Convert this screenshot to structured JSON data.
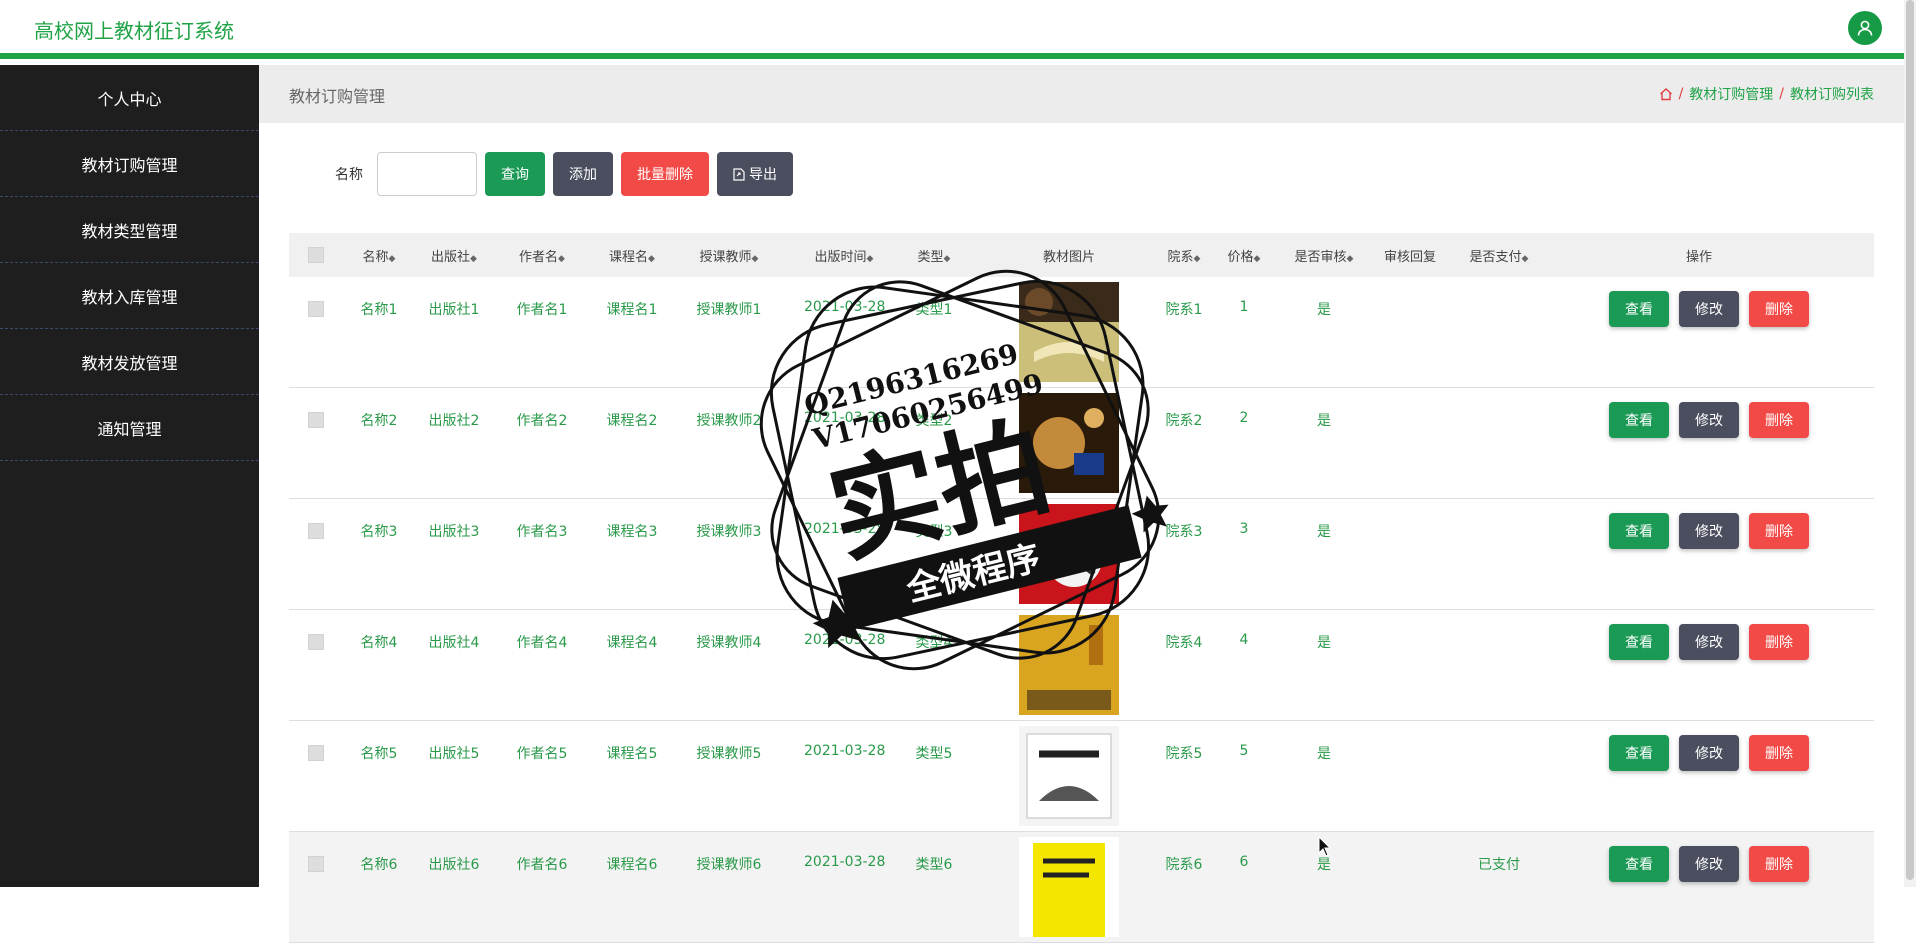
{
  "app": {
    "title": "高校网上教材征订系统"
  },
  "sidebar": {
    "items": [
      {
        "label": "个人中心"
      },
      {
        "label": "教材订购管理"
      },
      {
        "label": "教材类型管理"
      },
      {
        "label": "教材入库管理"
      },
      {
        "label": "教材发放管理"
      },
      {
        "label": "通知管理"
      }
    ]
  },
  "page": {
    "title": "教材订购管理",
    "breadcrumb": [
      "教材订购管理",
      "教材订购列表"
    ]
  },
  "toolbar": {
    "name_label": "名称",
    "name_value": "",
    "search_label": "查询",
    "add_label": "添加",
    "batch_delete_label": "批量删除",
    "export_label": "导出"
  },
  "table": {
    "headers": {
      "name": "名称",
      "publisher": "出版社",
      "author": "作者名",
      "course": "课程名",
      "teacher": "授课教师",
      "pubdate": "出版时间",
      "type": "类型",
      "image": "教材图片",
      "dept": "院系",
      "price": "价格",
      "audited": "是否审核",
      "reply": "审核回复",
      "paid": "是否支付",
      "ops": "操作"
    },
    "actions": {
      "view": "查看",
      "edit": "修改",
      "delete": "删除"
    },
    "rows": [
      {
        "name": "名称1",
        "publisher": "出版社1",
        "author": "作者名1",
        "course": "课程名1",
        "teacher": "授课教师1",
        "pubdate": "2021-03-28",
        "type": "类型1",
        "dept": "院系1",
        "price": "1",
        "audited": "是",
        "reply": "",
        "paid": ""
      },
      {
        "name": "名称2",
        "publisher": "出版社2",
        "author": "作者名2",
        "course": "课程名2",
        "teacher": "授课教师2",
        "pubdate": "2021-03-28",
        "type": "类型2",
        "dept": "院系2",
        "price": "2",
        "audited": "是",
        "reply": "",
        "paid": ""
      },
      {
        "name": "名称3",
        "publisher": "出版社3",
        "author": "作者名3",
        "course": "课程名3",
        "teacher": "授课教师3",
        "pubdate": "2021-03-28",
        "type": "类型3",
        "dept": "院系3",
        "price": "3",
        "audited": "是",
        "reply": "",
        "paid": ""
      },
      {
        "name": "名称4",
        "publisher": "出版社4",
        "author": "作者名4",
        "course": "课程名4",
        "teacher": "授课教师4",
        "pubdate": "2021-03-28",
        "type": "类型4",
        "dept": "院系4",
        "price": "4",
        "audited": "是",
        "reply": "",
        "paid": ""
      },
      {
        "name": "名称5",
        "publisher": "出版社5",
        "author": "作者名5",
        "course": "课程名5",
        "teacher": "授课教师5",
        "pubdate": "2021-03-28",
        "type": "类型5",
        "dept": "院系5",
        "price": "5",
        "audited": "是",
        "reply": "",
        "paid": ""
      },
      {
        "name": "名称6",
        "publisher": "出版社6",
        "author": "作者名6",
        "course": "课程名6",
        "teacher": "授课教师6",
        "pubdate": "2021-03-28",
        "type": "类型6",
        "dept": "院系6",
        "price": "6",
        "audited": "是",
        "reply": "",
        "paid": "已支付"
      }
    ]
  },
  "watermark": {
    "line1": "Q2196316269",
    "line2": "V17060256499",
    "main": "实拍",
    "banner": "全微程序"
  },
  "colors": {
    "accent": "#20a347",
    "sidebar_bg": "#1e1e1e",
    "danger": "#f24a46",
    "dark_button": "#4a4e5e"
  }
}
